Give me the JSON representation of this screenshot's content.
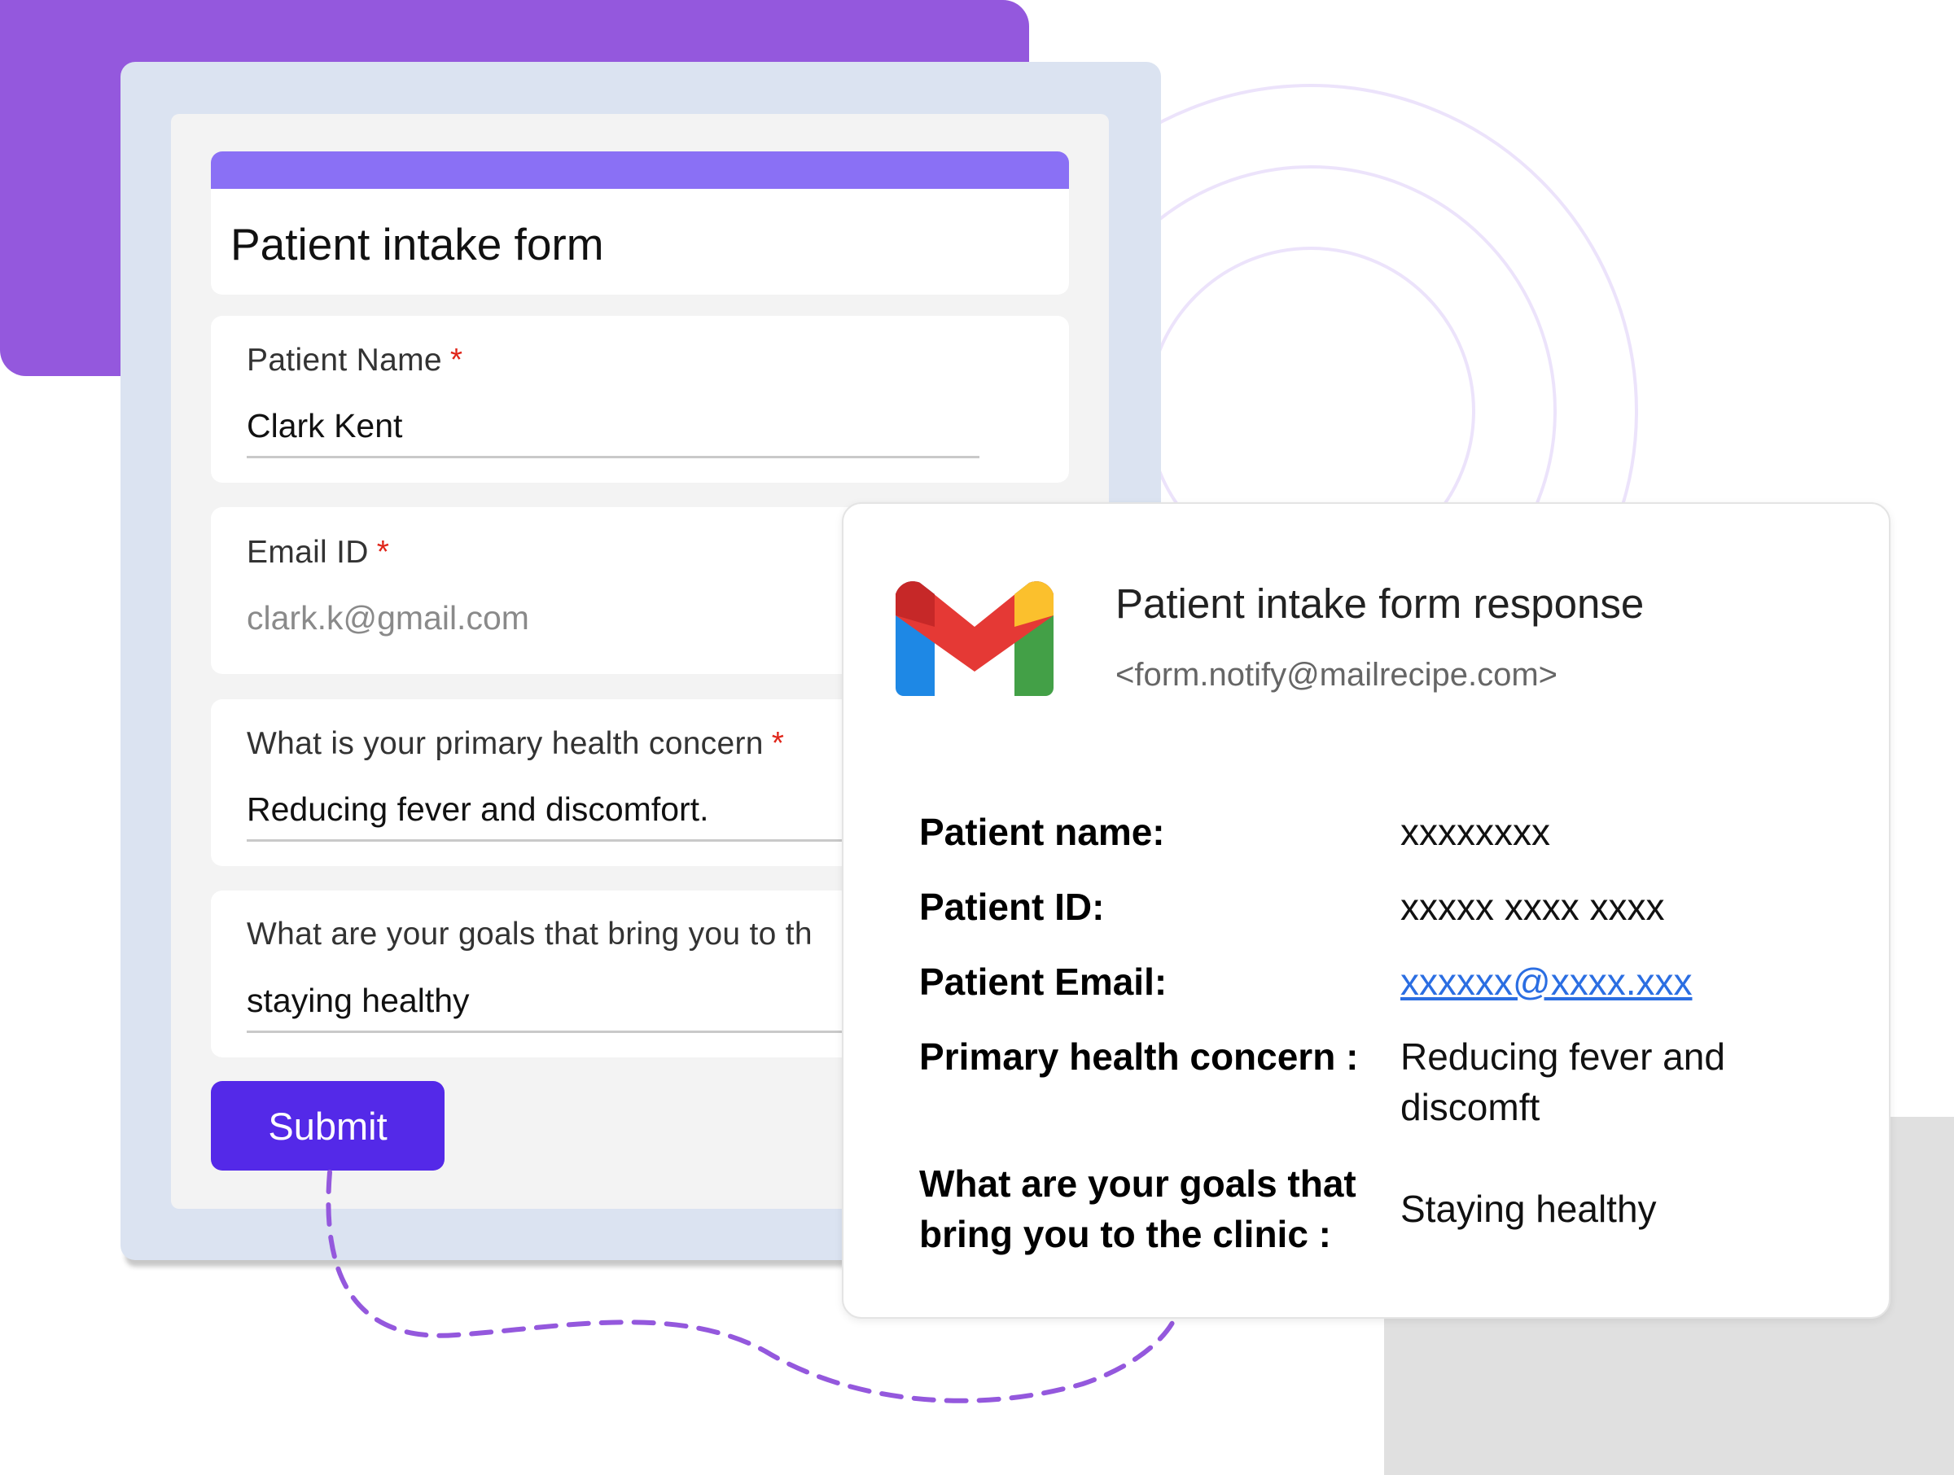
{
  "form": {
    "title": "Patient intake form",
    "fields": [
      {
        "label": "Patient Name",
        "required": "*",
        "value": "Clark Kent"
      },
      {
        "label": "Email ID",
        "required": "*",
        "value": "clark.k@gmail.com"
      },
      {
        "label": "What is your primary health concern",
        "required": "*",
        "value": "Reducing fever and discomfort."
      },
      {
        "label": "What are your goals that bring you to th",
        "value": "staying healthy"
      }
    ],
    "submit_label": "Submit"
  },
  "email": {
    "icon": "gmail-logo",
    "title": "Patient intake form response",
    "sender": "<form.notify@mailrecipe.com>",
    "rows": [
      {
        "label": "Patient name:",
        "value": "xxxxxxxx"
      },
      {
        "label": "Patient ID:",
        "value": "xxxxx xxxx xxxx"
      },
      {
        "label": "Patient Email:",
        "value": "xxxxxx@xxxx.xxx"
      },
      {
        "label": "Primary health concern :",
        "value_line1": "Reducing fever and",
        "value_line2": "discomft"
      },
      {
        "label_line1": "What are your goals that",
        "label_line2": "bring you to the clinic :",
        "value": "Staying healthy"
      }
    ]
  },
  "colors": {
    "accent_purple": "#9458dd",
    "form_header": "#8a70f5",
    "submit_button": "#5429e8",
    "required_star": "#e0261a",
    "link": "#2b6ee2"
  }
}
